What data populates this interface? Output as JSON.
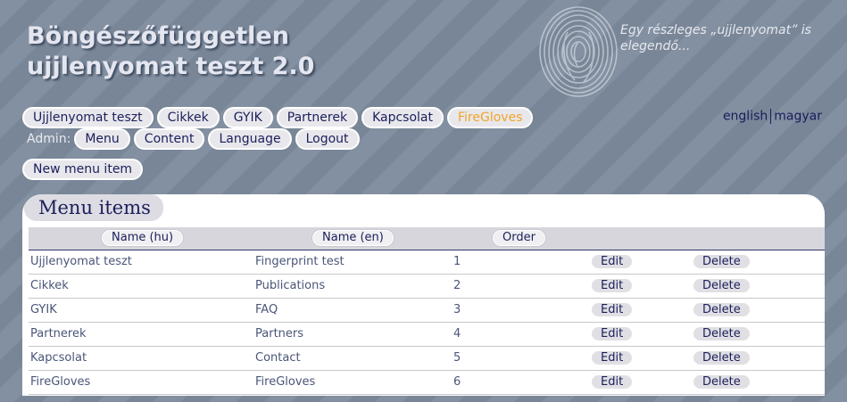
{
  "site": {
    "title_line1": "Böngészőfüggetlen",
    "title_line2": "ujjlenyomat teszt 2.0",
    "tagline": "Egy részleges „ujjlenyomat” is elegendő..."
  },
  "nav": {
    "items": [
      "Ujjlenyomat teszt",
      "Cikkek",
      "GYIK",
      "Partnerek",
      "Kapcsolat",
      "FireGloves"
    ],
    "active_index": 5
  },
  "admin": {
    "label": "Admin:",
    "items": [
      "Menu",
      "Content",
      "Language",
      "Logout"
    ]
  },
  "languages": {
    "english": "english",
    "magyar": "magyar"
  },
  "new_item_button": "New menu item",
  "panel": {
    "title": "Menu items",
    "columns": {
      "name_hu": "Name (hu)",
      "name_en": "Name (en)",
      "order": "Order"
    },
    "edit_label": "Edit",
    "delete_label": "Delete",
    "rows": [
      {
        "name_hu": "Ujjlenyomat teszt",
        "name_en": "Fingerprint test",
        "order": "1"
      },
      {
        "name_hu": "Cikkek",
        "name_en": "Publications",
        "order": "2"
      },
      {
        "name_hu": "GYIK",
        "name_en": "FAQ",
        "order": "3"
      },
      {
        "name_hu": "Partnerek",
        "name_en": "Partners",
        "order": "4"
      },
      {
        "name_hu": "Kapcsolat",
        "name_en": "Contact",
        "order": "5"
      },
      {
        "name_hu": "FireGloves",
        "name_en": "FireGloves",
        "order": "6"
      }
    ]
  },
  "colors": {
    "background": "#7c8a9c",
    "pill_text": "#1c1e5c",
    "active_pill_text": "#f0a428",
    "cell_text": "#4a5678"
  }
}
